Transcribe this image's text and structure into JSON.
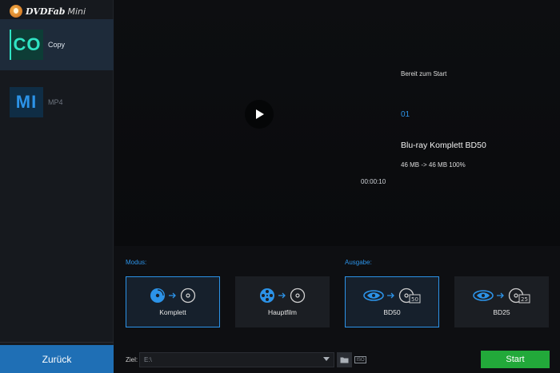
{
  "app": {
    "logo_text": "DVDFab",
    "logo_sub": "Mini"
  },
  "sidebar": {
    "items": [
      {
        "tile": "CO",
        "label": "Copy",
        "active": true
      },
      {
        "tile": "MI",
        "label": "MP4",
        "active": false
      }
    ],
    "back_label": "Zurück"
  },
  "preview": {
    "time": "00:00:10",
    "status": "Bereit zum Start",
    "title_number": "01",
    "disc_name": "Blu-ray Komplett BD50",
    "size_info": "46 MB -> 46 MB  100%"
  },
  "modus": {
    "label": "Modus:",
    "options": [
      {
        "label": "Komplett",
        "selected": true
      },
      {
        "label": "Hauptfilm",
        "selected": false
      }
    ]
  },
  "ausgabe": {
    "label": "Ausgabe:",
    "options": [
      {
        "label": "BD50",
        "badge": "50",
        "selected": true
      },
      {
        "label": "BD25",
        "badge": "25",
        "selected": false
      }
    ]
  },
  "bottom": {
    "ziel_label": "Ziel:",
    "ziel_value": "E:\\",
    "iso_label": "ISO",
    "start_label": "Start"
  },
  "colors": {
    "accent": "#2c93e8",
    "start": "#22a93a",
    "back": "#1f6fb5",
    "copy_tile": "#30e3c4"
  }
}
